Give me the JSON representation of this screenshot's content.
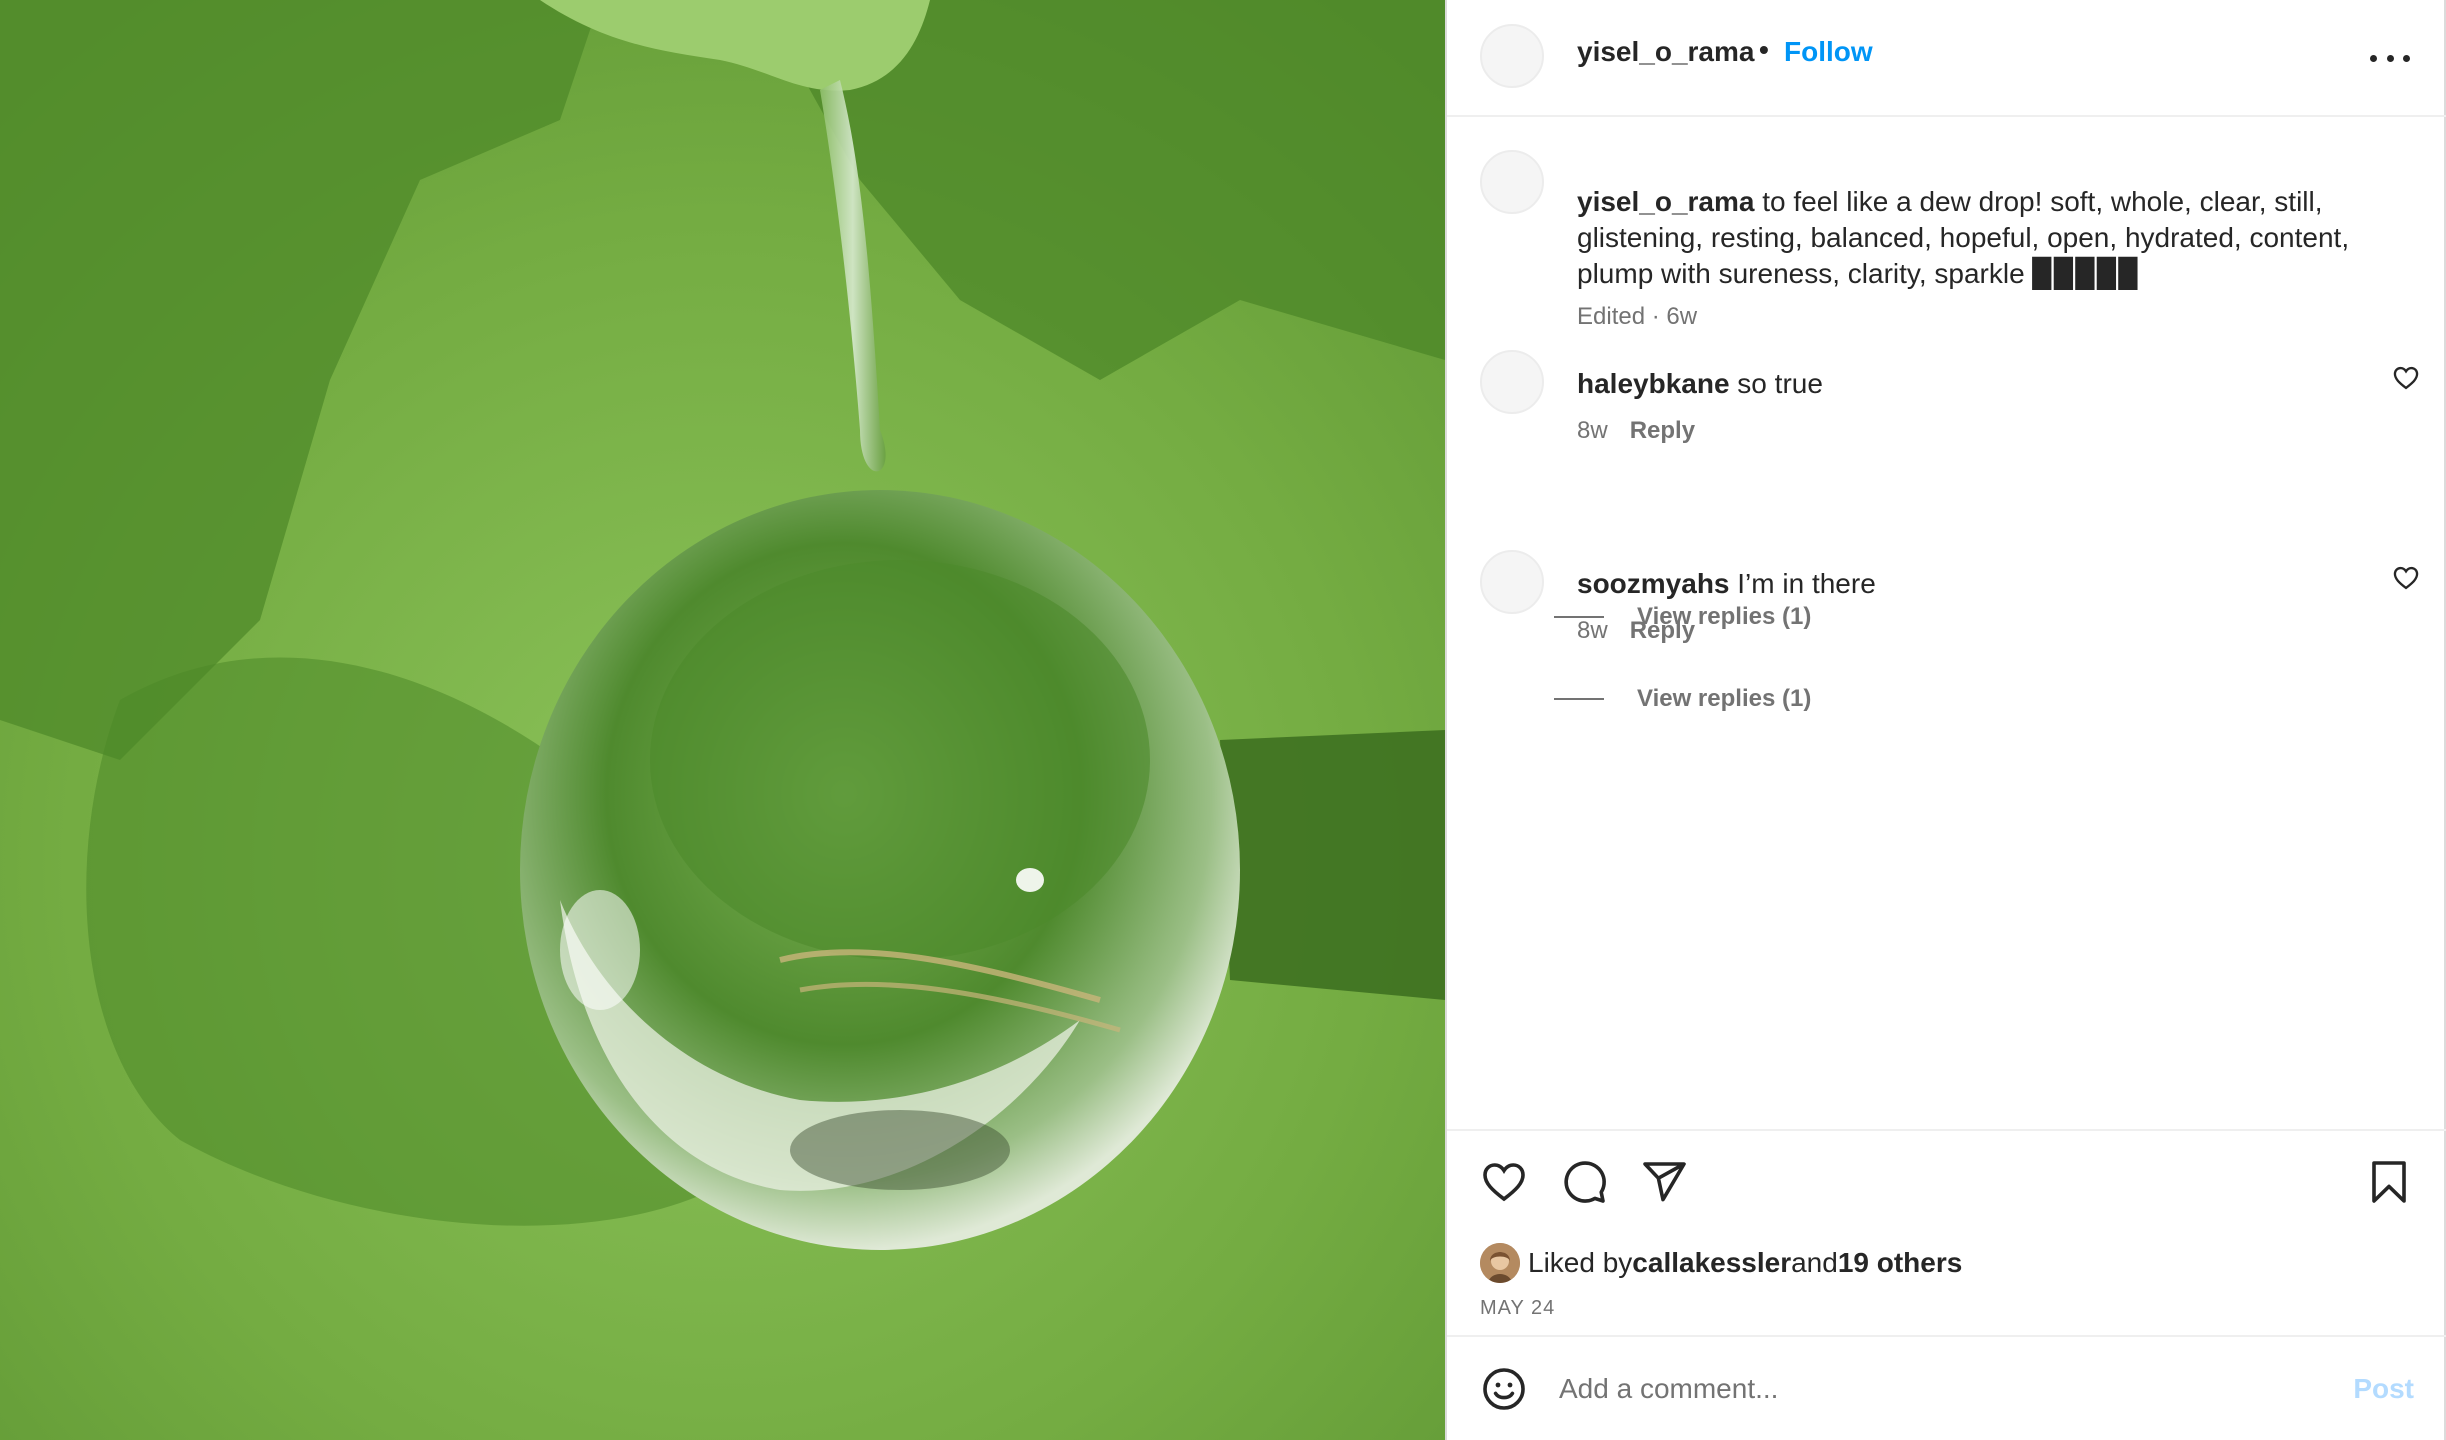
{
  "post": {
    "author": "yisel_o_rama",
    "header_dot": "•",
    "follow_label": "Follow",
    "caption_user": "yisel_o_rama",
    "caption_text": " to feel like a dew drop! soft, whole, clear, still, glistening, resting, balanced, hopeful, open, hydrated, content, plump with sureness, clarity, sparkle ▉▉▉▉▉",
    "caption_meta": "Edited · 6w"
  },
  "comments": [
    {
      "user": "haleybkane",
      "text": " so true",
      "age": "8w",
      "reply_label": "Reply",
      "view_replies": "View replies (1)"
    },
    {
      "user": "soozmyahs",
      "text": " I’m in there",
      "age": "8w",
      "reply_label": "Reply",
      "view_replies": "View replies (1)"
    }
  ],
  "likes": {
    "prefix": "Liked by ",
    "liker": "callakessler",
    "middle": " and ",
    "others": "19 others"
  },
  "date": "MAY 24",
  "composer": {
    "placeholder": "Add a comment...",
    "post_label": "Post"
  },
  "icons": {
    "more": "more-horizontal-icon",
    "like": "heart-icon",
    "comment": "comment-bubble-icon",
    "share": "paper-plane-icon",
    "save": "bookmark-icon",
    "emoji": "smiley-icon"
  },
  "colors": {
    "accent": "#0095f6",
    "post_disabled": "#b3dbff",
    "muted": "#737373"
  }
}
